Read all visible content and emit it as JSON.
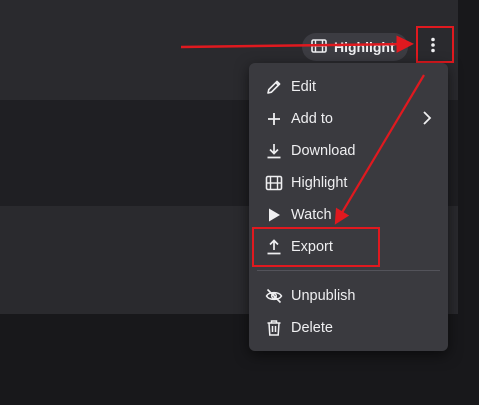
{
  "toolbar": {
    "highlight_label": "Highlight",
    "highlight_icon": "film-icon",
    "more_icon": "kebab-icon"
  },
  "menu": {
    "items": [
      {
        "label": "Edit",
        "icon": "pencil-icon"
      },
      {
        "label": "Add to",
        "icon": "plus-icon",
        "submenu": true
      },
      {
        "label": "Download",
        "icon": "download-icon"
      },
      {
        "label": "Highlight",
        "icon": "film-icon"
      },
      {
        "label": "Watch",
        "icon": "play-icon"
      },
      {
        "label": "Export",
        "icon": "upload-icon",
        "emphasized": true
      },
      {
        "label": "Unpublish",
        "icon": "eye-off-icon"
      },
      {
        "label": "Delete",
        "icon": "trash-icon"
      }
    ]
  },
  "annotations": {
    "color": "#e0191f"
  }
}
